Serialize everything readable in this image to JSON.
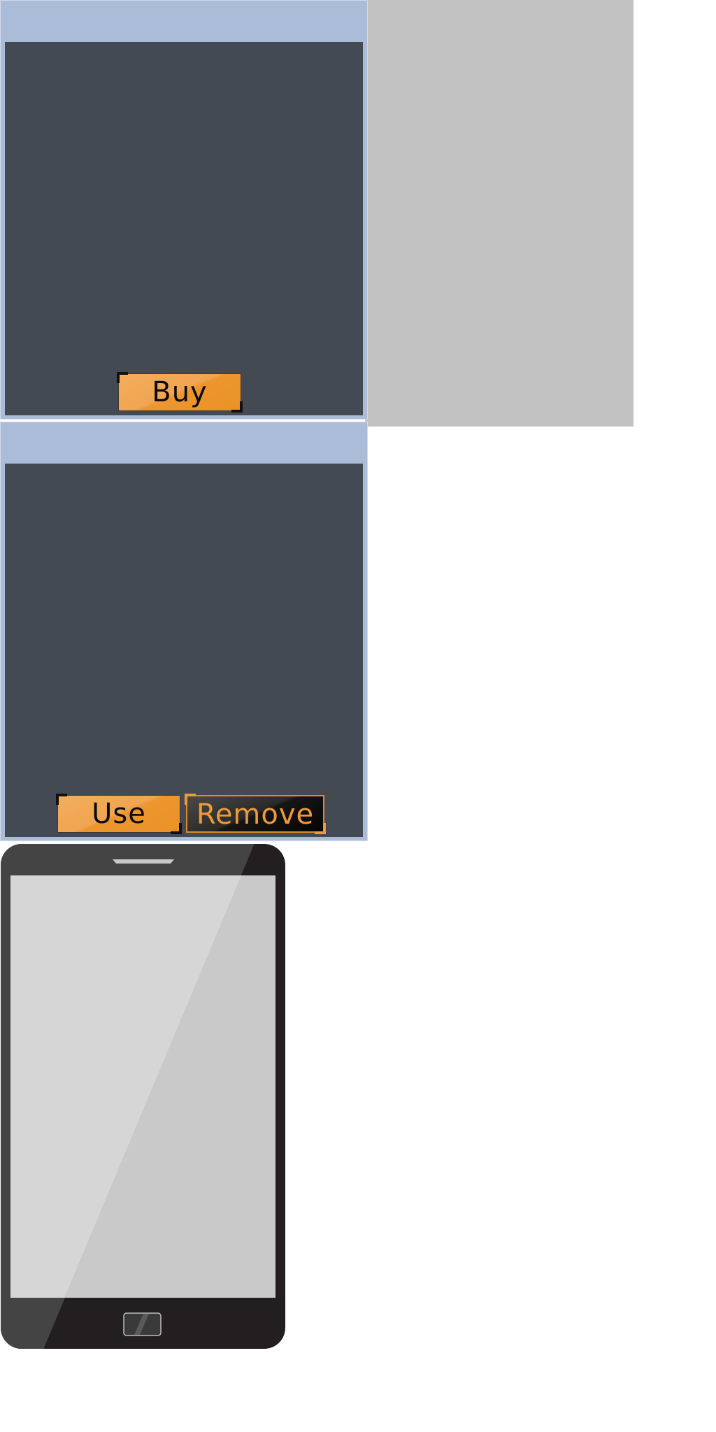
{
  "shop_panel": {
    "buy_label": "Buy"
  },
  "inventory_panel": {
    "use_label": "Use",
    "remove_label": "Remove"
  },
  "colors": {
    "panel_header": "#abbcd8",
    "panel_content": "#444a54",
    "accent_orange": "#ec962e",
    "backdrop_grey": "#c2c2c2",
    "phone_body": "#231f20",
    "phone_screen": "#c9c9c9"
  },
  "icons": {
    "device": "smartphone-icon"
  }
}
